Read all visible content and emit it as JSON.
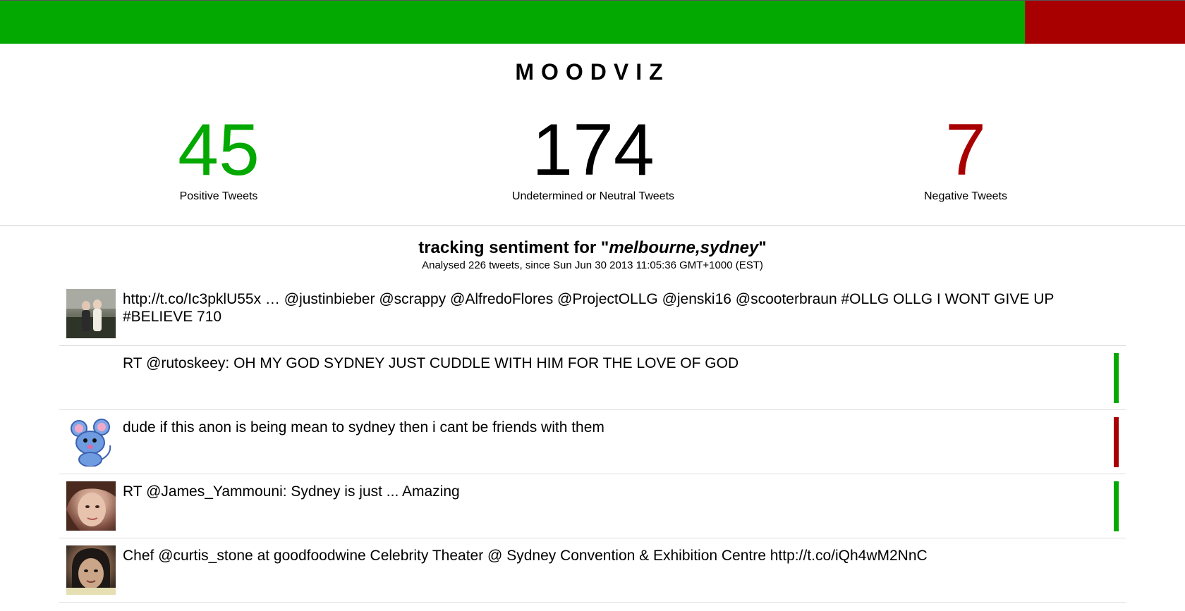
{
  "colors": {
    "positive": "#03a800",
    "negative": "#a80000",
    "neutral": "#000000"
  },
  "mood_bar": {
    "positive_fraction": 0.865
  },
  "app": {
    "title": "MOODVIZ"
  },
  "stats": {
    "positive": {
      "count": "45",
      "label": "Positive Tweets"
    },
    "neutral": {
      "count": "174",
      "label": "Undetermined or Neutral Tweets"
    },
    "negative": {
      "count": "7",
      "label": "Negative Tweets"
    }
  },
  "tracking": {
    "prefix": "tracking sentiment for \"",
    "query": "melbourne,sydney",
    "suffix": "\"",
    "summary": "Analysed 226 tweets, since Sun Jun 30 2013 11:05:36 GMT+1000 (EST)"
  },
  "tweets": [
    {
      "text": "http://t.co/Ic3pklU55x … @justinbieber @scrappy @AlfredoFlores @ProjectOLLG @jenski16 @scooterbraun #OLLG OLLG I WONT GIVE UP #BELIEVE 710",
      "sentiment": "neutral",
      "avatar": "photo-two-people"
    },
    {
      "text": "RT @rutoskeey: OH MY GOD SYDNEY JUST CUDDLE WITH HIM FOR THE LOVE OF GOD",
      "sentiment": "positive",
      "avatar": "none"
    },
    {
      "text": "dude if this anon is being mean to sydney then i cant be friends with them",
      "sentiment": "negative",
      "avatar": "cartoon-mouse"
    },
    {
      "text": "RT @James_Yammouni: Sydney is just ... Amazing",
      "sentiment": "positive",
      "avatar": "photo-face"
    },
    {
      "text": "Chef @curtis_stone at goodfoodwine Celebrity Theater @ Sydney Convention & Exhibition Centre http://t.co/iQh4wM2NnC",
      "sentiment": "neutral",
      "avatar": "photo-face-2"
    }
  ]
}
